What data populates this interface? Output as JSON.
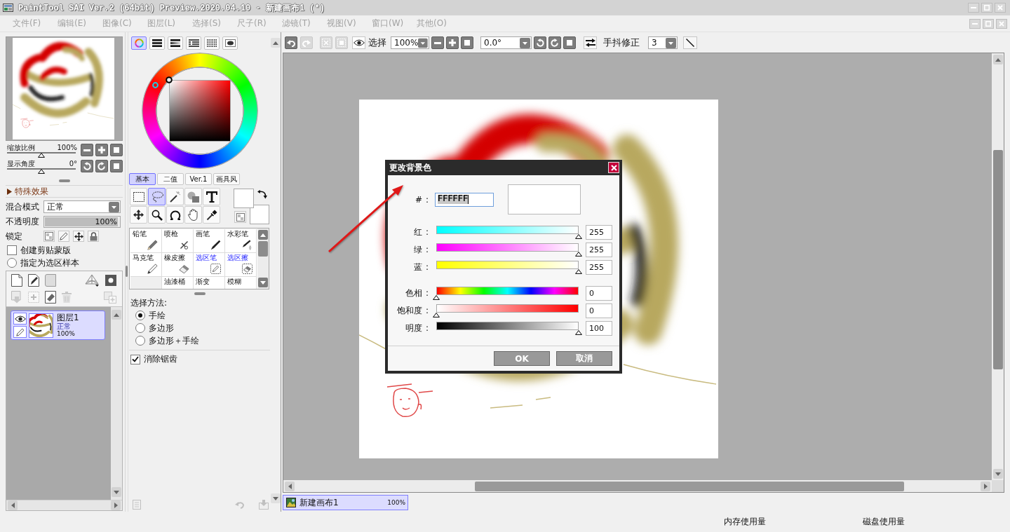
{
  "window": {
    "title": "PaintTool SAI Ver.2 (64bit) Preview.2020.04.10 - 新建画布1 (*)"
  },
  "menu": [
    {
      "label": "文件(F)",
      "disabled": true
    },
    {
      "label": "编辑(E)",
      "disabled": true
    },
    {
      "label": "图像(C)",
      "disabled": true
    },
    {
      "label": "图层(L)",
      "disabled": true
    },
    {
      "label": "选择(S)",
      "disabled": true
    },
    {
      "label": "尺子(R)",
      "disabled": true
    },
    {
      "label": "滤镜(T)",
      "disabled": true
    },
    {
      "label": "视图(V)",
      "disabled": true
    },
    {
      "label": "窗口(W)",
      "disabled": true
    },
    {
      "label": "其他(O)",
      "disabled": true
    }
  ],
  "navigator": {
    "sliders": [
      {
        "label": "缩放比例",
        "reading": "100%",
        "level": 0.5
      },
      {
        "label": "显示角度",
        "reading": "0°",
        "level": 0.5
      }
    ]
  },
  "layer_panel": {
    "effects": {
      "label": "特殊效果",
      "expanded": false
    },
    "blend": {
      "label": "混合模式",
      "value": "正常"
    },
    "opacity": {
      "label": "不透明度",
      "reading": "100%",
      "level": 1
    },
    "lock": {
      "label": "锁定"
    },
    "options": [
      {
        "kind": "checkbox",
        "label": "创建剪贴蒙版",
        "checked": false
      },
      {
        "kind": "radio",
        "label": "指定为选区样本",
        "checked": false
      }
    ],
    "tools": [
      {
        "kind": "new",
        "disabled": false
      },
      {
        "kind": "linework",
        "disabled": false
      },
      {
        "kind": "folder",
        "disabled": false
      },
      {
        "kind": "perspective",
        "disabled": false
      },
      {
        "kind": "mask",
        "disabled": false
      },
      {
        "kind": "merge",
        "disabled": true
      },
      {
        "kind": "transfer",
        "disabled": true
      },
      {
        "kind": "clear",
        "disabled": false
      },
      {
        "kind": "delete",
        "disabled": true
      },
      {
        "kind": "combine",
        "disabled": true
      }
    ],
    "layers": [
      {
        "name": "图层1",
        "mode": "正常",
        "opacity": "100%",
        "selected": true,
        "visible": true
      }
    ]
  },
  "color_panel": {
    "modes": [
      {
        "kind": "wheel",
        "selected": true
      },
      {
        "kind": "rgb",
        "selected": false
      },
      {
        "kind": "hsv",
        "selected": false
      },
      {
        "kind": "swatches",
        "selected": false
      },
      {
        "kind": "palette",
        "selected": false
      },
      {
        "kind": "scratchpad",
        "selected": false
      }
    ],
    "swatches": {
      "foreground": {
        "color": "#ffffff"
      },
      "background": {
        "color": "#ffffff"
      }
    }
  },
  "tool_panel": {
    "tabs": [
      {
        "label": "基本",
        "selected": true
      },
      {
        "label": "二值",
        "selected": false
      },
      {
        "label": "Ver.1",
        "selected": false
      },
      {
        "label": "画具风",
        "selected": false
      }
    ],
    "tools": [
      {
        "kind": "marquee",
        "selected": false
      },
      {
        "kind": "lasso",
        "selected": true
      },
      {
        "kind": "wand",
        "selected": false
      },
      {
        "kind": "shape",
        "selected": false
      },
      {
        "kind": "text",
        "selected": false
      },
      {
        "kind": "move",
        "selected": false
      },
      {
        "kind": "zoom",
        "selected": false
      },
      {
        "kind": "rotate",
        "selected": false
      },
      {
        "kind": "hand",
        "selected": false
      },
      {
        "kind": "eyedropper",
        "selected": false
      }
    ],
    "brushes": [
      {
        "kind": "pencil",
        "name": "铅笔",
        "selected": false
      },
      {
        "kind": "airbrush",
        "name": "喷枪",
        "selected": false
      },
      {
        "kind": "brush",
        "name": "画笔",
        "selected": false
      },
      {
        "kind": "watercolor",
        "name": "水彩笔",
        "selected": false
      },
      {
        "kind": "marker",
        "name": "马克笔",
        "selected": false
      },
      {
        "kind": "eraser",
        "name": "橡皮擦",
        "selected": false
      },
      {
        "kind": "selpen",
        "name": "选区笔",
        "selected": false
      },
      {
        "kind": "selerase",
        "name": "选区擦",
        "selected": false
      },
      {
        "kind": "empty"
      },
      {
        "kind": "bucket",
        "name": "油漆桶",
        "selected": false
      },
      {
        "kind": "gradient",
        "name": "渐变",
        "selected": false
      },
      {
        "kind": "blur",
        "name": "模糊",
        "selected": false
      }
    ],
    "selection_method": {
      "label": "选择方法:",
      "options": [
        {
          "label": "手绘",
          "selected": true
        },
        {
          "label": "多边形",
          "selected": false
        },
        {
          "label": "多边形＋手绘",
          "selected": false
        }
      ]
    },
    "antialias": {
      "label": "消除锯齿",
      "checked": true
    },
    "actions": [
      {
        "kind": "note",
        "disabled": true
      },
      {
        "kind": "undo",
        "disabled": true
      },
      {
        "kind": "save",
        "disabled": true
      }
    ]
  },
  "canvas_toolbar": {
    "buttons": [
      {
        "kind": "undo",
        "disabled": false
      },
      {
        "kind": "redo",
        "disabled": true
      },
      {
        "kind": "deselect",
        "disabled": true
      },
      {
        "kind": "invert",
        "disabled": true
      }
    ],
    "view_label": "选择",
    "zoom": "100%",
    "angle": "0.0°",
    "stabilizer_label": "手抖修正",
    "stabilizer": "3"
  },
  "dialog": {
    "title": "更改背景色",
    "hex": {
      "label": "#",
      "separator": ":",
      "value": "FFFFFF",
      "highlighted": true
    },
    "rgb": [
      {
        "label": "红",
        "separator": ":",
        "value": "255",
        "level": 1
      },
      {
        "label": "绿",
        "separator": ":",
        "value": "255",
        "level": 1
      },
      {
        "label": "蓝",
        "separator": ":",
        "value": "255",
        "level": 1
      }
    ],
    "hsv": [
      {
        "label": "色相",
        "separator": ":",
        "value": "0",
        "level": 0
      },
      {
        "label": "饱和度",
        "separator": ":",
        "value": "0",
        "level": 0
      },
      {
        "label": "明度",
        "separator": ":",
        "value": "100",
        "level": 1
      }
    ],
    "buttons": [
      {
        "label": "OK"
      },
      {
        "label": "取消"
      }
    ]
  },
  "documents": [
    {
      "name": "新建画布1",
      "zoom": "100%",
      "selected": true
    }
  ],
  "status_bar": {
    "memory_label": "内存使用量",
    "disk_label": "磁盘使用量"
  }
}
